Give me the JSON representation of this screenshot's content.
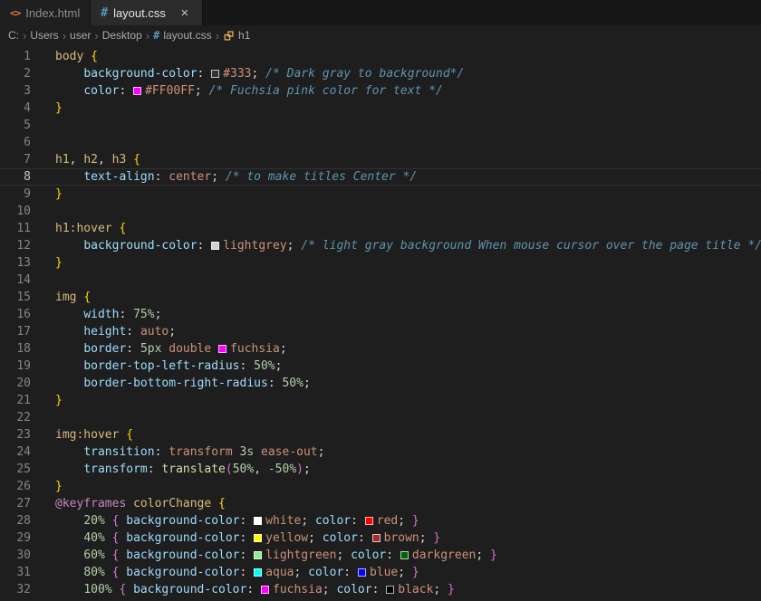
{
  "icons": {
    "html": "<>",
    "css": "#",
    "close": "×",
    "chevron": "›"
  },
  "tabs": [
    {
      "label": "Index.html",
      "icon": "html",
      "active": false
    },
    {
      "label": "layout.css",
      "icon": "css",
      "active": true
    }
  ],
  "breadcrumb": {
    "items": [
      {
        "label": "C:"
      },
      {
        "label": "Users"
      },
      {
        "label": "user"
      },
      {
        "label": "Desktop"
      },
      {
        "label": "layout.css",
        "icon": "css"
      },
      {
        "label": "h1",
        "icon": "symbol"
      }
    ]
  },
  "editor": {
    "current_line": 8,
    "token_colors": {
      "sel": "#d7ba7d",
      "prop": "#9cdcfe",
      "val": "#ce9178",
      "num": "#b5cea8",
      "pun": "#d4d4d4",
      "com": "#5d94b0",
      "at": "#c586c0",
      "fn": "#dcdcaa",
      "b1": "#ffd700",
      "b2": "#da70d6"
    },
    "lines": [
      [
        {
          "t": "body",
          "c": "sel"
        },
        {
          "t": " ",
          "c": "pun"
        },
        {
          "t": "{",
          "c": "b1"
        }
      ],
      [
        {
          "t": "    ",
          "c": "pun"
        },
        {
          "t": "background-color",
          "c": "prop"
        },
        {
          "t": ": ",
          "c": "pun"
        },
        {
          "sw": "#333333"
        },
        {
          "t": "#333",
          "c": "val"
        },
        {
          "t": "; ",
          "c": "pun"
        },
        {
          "t": "/* Dark gray to background*/",
          "c": "com"
        }
      ],
      [
        {
          "t": "    ",
          "c": "pun"
        },
        {
          "t": "color",
          "c": "prop"
        },
        {
          "t": ": ",
          "c": "pun"
        },
        {
          "sw": "#ff00ff"
        },
        {
          "t": "#FF00FF",
          "c": "val"
        },
        {
          "t": "; ",
          "c": "pun"
        },
        {
          "t": "/* Fuchsia pink color for text */",
          "c": "com"
        }
      ],
      [
        {
          "t": "}",
          "c": "b1"
        }
      ],
      [],
      [],
      [
        {
          "t": "h1",
          "c": "sel"
        },
        {
          "t": ", ",
          "c": "pun"
        },
        {
          "t": "h2",
          "c": "sel"
        },
        {
          "t": ", ",
          "c": "pun"
        },
        {
          "t": "h3",
          "c": "sel"
        },
        {
          "t": " ",
          "c": "pun"
        },
        {
          "t": "{",
          "c": "b1"
        }
      ],
      [
        {
          "t": "    ",
          "c": "pun"
        },
        {
          "t": "text-align",
          "c": "prop"
        },
        {
          "t": ": ",
          "c": "pun"
        },
        {
          "t": "center",
          "c": "val"
        },
        {
          "t": "; ",
          "c": "pun"
        },
        {
          "t": "/* to make titles Center */",
          "c": "com"
        }
      ],
      [
        {
          "t": "}",
          "c": "b1"
        }
      ],
      [],
      [
        {
          "t": "h1:hover",
          "c": "sel"
        },
        {
          "t": " ",
          "c": "pun"
        },
        {
          "t": "{",
          "c": "b1"
        }
      ],
      [
        {
          "t": "    ",
          "c": "pun"
        },
        {
          "t": "background-color",
          "c": "prop"
        },
        {
          "t": ": ",
          "c": "pun"
        },
        {
          "sw": "#d3d3d3"
        },
        {
          "t": "lightgrey",
          "c": "val"
        },
        {
          "t": "; ",
          "c": "pun"
        },
        {
          "t": "/* light gray background When mouse cursor over the page title */",
          "c": "com"
        }
      ],
      [
        {
          "t": "}",
          "c": "b1"
        }
      ],
      [],
      [
        {
          "t": "img",
          "c": "sel"
        },
        {
          "t": " ",
          "c": "pun"
        },
        {
          "t": "{",
          "c": "b1"
        }
      ],
      [
        {
          "t": "    ",
          "c": "pun"
        },
        {
          "t": "width",
          "c": "prop"
        },
        {
          "t": ": ",
          "c": "pun"
        },
        {
          "t": "75%",
          "c": "num"
        },
        {
          "t": ";",
          "c": "pun"
        }
      ],
      [
        {
          "t": "    ",
          "c": "pun"
        },
        {
          "t": "height",
          "c": "prop"
        },
        {
          "t": ": ",
          "c": "pun"
        },
        {
          "t": "auto",
          "c": "val"
        },
        {
          "t": ";",
          "c": "pun"
        }
      ],
      [
        {
          "t": "    ",
          "c": "pun"
        },
        {
          "t": "border",
          "c": "prop"
        },
        {
          "t": ": ",
          "c": "pun"
        },
        {
          "t": "5px",
          "c": "num"
        },
        {
          "t": " ",
          "c": "pun"
        },
        {
          "t": "double",
          "c": "val"
        },
        {
          "t": " ",
          "c": "pun"
        },
        {
          "sw": "#ff00ff"
        },
        {
          "t": "fuchsia",
          "c": "val"
        },
        {
          "t": ";",
          "c": "pun"
        }
      ],
      [
        {
          "t": "    ",
          "c": "pun"
        },
        {
          "t": "border-top-left-radius",
          "c": "prop"
        },
        {
          "t": ": ",
          "c": "pun"
        },
        {
          "t": "50%",
          "c": "num"
        },
        {
          "t": ";",
          "c": "pun"
        }
      ],
      [
        {
          "t": "    ",
          "c": "pun"
        },
        {
          "t": "border-bottom-right-radius",
          "c": "prop"
        },
        {
          "t": ": ",
          "c": "pun"
        },
        {
          "t": "50%",
          "c": "num"
        },
        {
          "t": ";",
          "c": "pun"
        }
      ],
      [
        {
          "t": "}",
          "c": "b1"
        }
      ],
      [],
      [
        {
          "t": "img:hover",
          "c": "sel"
        },
        {
          "t": " ",
          "c": "pun"
        },
        {
          "t": "{",
          "c": "b1"
        }
      ],
      [
        {
          "t": "    ",
          "c": "pun"
        },
        {
          "t": "transition",
          "c": "prop"
        },
        {
          "t": ": ",
          "c": "pun"
        },
        {
          "t": "transform",
          "c": "val"
        },
        {
          "t": " ",
          "c": "pun"
        },
        {
          "t": "3s",
          "c": "num"
        },
        {
          "t": " ",
          "c": "pun"
        },
        {
          "t": "ease-out",
          "c": "val"
        },
        {
          "t": ";",
          "c": "pun"
        }
      ],
      [
        {
          "t": "    ",
          "c": "pun"
        },
        {
          "t": "transform",
          "c": "prop"
        },
        {
          "t": ": ",
          "c": "pun"
        },
        {
          "t": "translate",
          "c": "fn"
        },
        {
          "t": "(",
          "c": "b2"
        },
        {
          "t": "50%",
          "c": "num"
        },
        {
          "t": ", ",
          "c": "pun"
        },
        {
          "t": "-50%",
          "c": "num"
        },
        {
          "t": ")",
          "c": "b2"
        },
        {
          "t": ";",
          "c": "pun"
        }
      ],
      [
        {
          "t": "}",
          "c": "b1"
        }
      ],
      [
        {
          "t": "@keyframes",
          "c": "at"
        },
        {
          "t": " ",
          "c": "pun"
        },
        {
          "t": "colorChange",
          "c": "sel"
        },
        {
          "t": " ",
          "c": "pun"
        },
        {
          "t": "{",
          "c": "b1"
        }
      ],
      [
        {
          "t": "    ",
          "c": "pun"
        },
        {
          "t": "20%",
          "c": "num"
        },
        {
          "t": " ",
          "c": "pun"
        },
        {
          "t": "{",
          "c": "b2"
        },
        {
          "t": " ",
          "c": "pun"
        },
        {
          "t": "background-color",
          "c": "prop"
        },
        {
          "t": ": ",
          "c": "pun"
        },
        {
          "sw": "#ffffff"
        },
        {
          "t": "white",
          "c": "val"
        },
        {
          "t": "; ",
          "c": "pun"
        },
        {
          "t": "color",
          "c": "prop"
        },
        {
          "t": ": ",
          "c": "pun"
        },
        {
          "sw": "#ff0000"
        },
        {
          "t": "red",
          "c": "val"
        },
        {
          "t": "; ",
          "c": "pun"
        },
        {
          "t": "}",
          "c": "b2"
        }
      ],
      [
        {
          "t": "    ",
          "c": "pun"
        },
        {
          "t": "40%",
          "c": "num"
        },
        {
          "t": " ",
          "c": "pun"
        },
        {
          "t": "{",
          "c": "b2"
        },
        {
          "t": " ",
          "c": "pun"
        },
        {
          "t": "background-color",
          "c": "prop"
        },
        {
          "t": ": ",
          "c": "pun"
        },
        {
          "sw": "#ffff00"
        },
        {
          "t": "yellow",
          "c": "val"
        },
        {
          "t": "; ",
          "c": "pun"
        },
        {
          "t": "color",
          "c": "prop"
        },
        {
          "t": ": ",
          "c": "pun"
        },
        {
          "sw": "#a52a2a"
        },
        {
          "t": "brown",
          "c": "val"
        },
        {
          "t": "; ",
          "c": "pun"
        },
        {
          "t": "}",
          "c": "b2"
        }
      ],
      [
        {
          "t": "    ",
          "c": "pun"
        },
        {
          "t": "60%",
          "c": "num"
        },
        {
          "t": " ",
          "c": "pun"
        },
        {
          "t": "{",
          "c": "b2"
        },
        {
          "t": " ",
          "c": "pun"
        },
        {
          "t": "background-color",
          "c": "prop"
        },
        {
          "t": ": ",
          "c": "pun"
        },
        {
          "sw": "#90ee90"
        },
        {
          "t": "lightgreen",
          "c": "val"
        },
        {
          "t": "; ",
          "c": "pun"
        },
        {
          "t": "color",
          "c": "prop"
        },
        {
          "t": ": ",
          "c": "pun"
        },
        {
          "sw": "#006400"
        },
        {
          "t": "darkgreen",
          "c": "val"
        },
        {
          "t": "; ",
          "c": "pun"
        },
        {
          "t": "}",
          "c": "b2"
        }
      ],
      [
        {
          "t": "    ",
          "c": "pun"
        },
        {
          "t": "80%",
          "c": "num"
        },
        {
          "t": " ",
          "c": "pun"
        },
        {
          "t": "{",
          "c": "b2"
        },
        {
          "t": " ",
          "c": "pun"
        },
        {
          "t": "background-color",
          "c": "prop"
        },
        {
          "t": ": ",
          "c": "pun"
        },
        {
          "sw": "#00ffff"
        },
        {
          "t": "aqua",
          "c": "val"
        },
        {
          "t": "; ",
          "c": "pun"
        },
        {
          "t": "color",
          "c": "prop"
        },
        {
          "t": ": ",
          "c": "pun"
        },
        {
          "sw": "#0000ff"
        },
        {
          "t": "blue",
          "c": "val"
        },
        {
          "t": "; ",
          "c": "pun"
        },
        {
          "t": "}",
          "c": "b2"
        }
      ],
      [
        {
          "t": "    ",
          "c": "pun"
        },
        {
          "t": "100%",
          "c": "num"
        },
        {
          "t": " ",
          "c": "pun"
        },
        {
          "t": "{",
          "c": "b2"
        },
        {
          "t": " ",
          "c": "pun"
        },
        {
          "t": "background-color",
          "c": "prop"
        },
        {
          "t": ": ",
          "c": "pun"
        },
        {
          "sw": "#ff00ff"
        },
        {
          "t": "fuchsia",
          "c": "val"
        },
        {
          "t": "; ",
          "c": "pun"
        },
        {
          "t": "color",
          "c": "prop"
        },
        {
          "t": ": ",
          "c": "pun"
        },
        {
          "sw": "#000000"
        },
        {
          "t": "black",
          "c": "val"
        },
        {
          "t": "; ",
          "c": "pun"
        },
        {
          "t": "}",
          "c": "b2"
        }
      ]
    ]
  }
}
